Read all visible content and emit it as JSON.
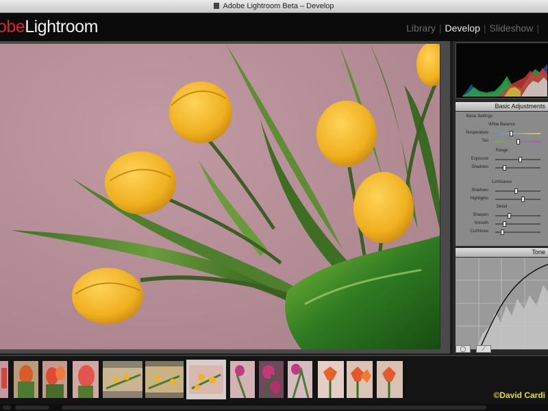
{
  "window": {
    "title": "Adobe Lightroom Beta – Develop"
  },
  "brand": {
    "part_a": "obe",
    "part_b": "Lightroom"
  },
  "modules": [
    {
      "label": "Library",
      "active": false
    },
    {
      "label": "Develop",
      "active": true
    },
    {
      "label": "Slideshow",
      "active": false
    }
  ],
  "panels": {
    "basic": {
      "header": "Basic Adjustments",
      "settings_label": "Basic Settings",
      "white_balance_label": "White Balance",
      "temperature_label": "Temperature",
      "tint_label": "Tint",
      "range_label": "Range",
      "exposure_label": "Exposure",
      "shadows_label": "Shadows",
      "luminance_label": "Luminance",
      "brightness_label": "Shadows",
      "highlights_label": "Highlights",
      "detail_label": "Detail",
      "sharpen_label": "Sharpen",
      "smooth_label": "Smooth",
      "saturation_label": "Cut/Noise"
    },
    "tone": {
      "header": "Tone"
    }
  },
  "slider_values": {
    "temperature": 0.35,
    "tint": 0.5,
    "exposure": 0.55,
    "shadows": 0.2,
    "lum_shadows": 0.45,
    "highlights": 0.6,
    "sharpen": 0.3,
    "smooth": 0.2,
    "cutnoise": 0.15
  },
  "filmstrip": {
    "selected_index": 6,
    "copyright": "©David Cardi"
  },
  "colors": {
    "brand_red": "#d8262b",
    "wall_pink": "#b98a94",
    "tulip_yellow": "#f0b322",
    "leaf_green": "#4f8a2d",
    "copyright_yellow": "#e3e21c"
  }
}
